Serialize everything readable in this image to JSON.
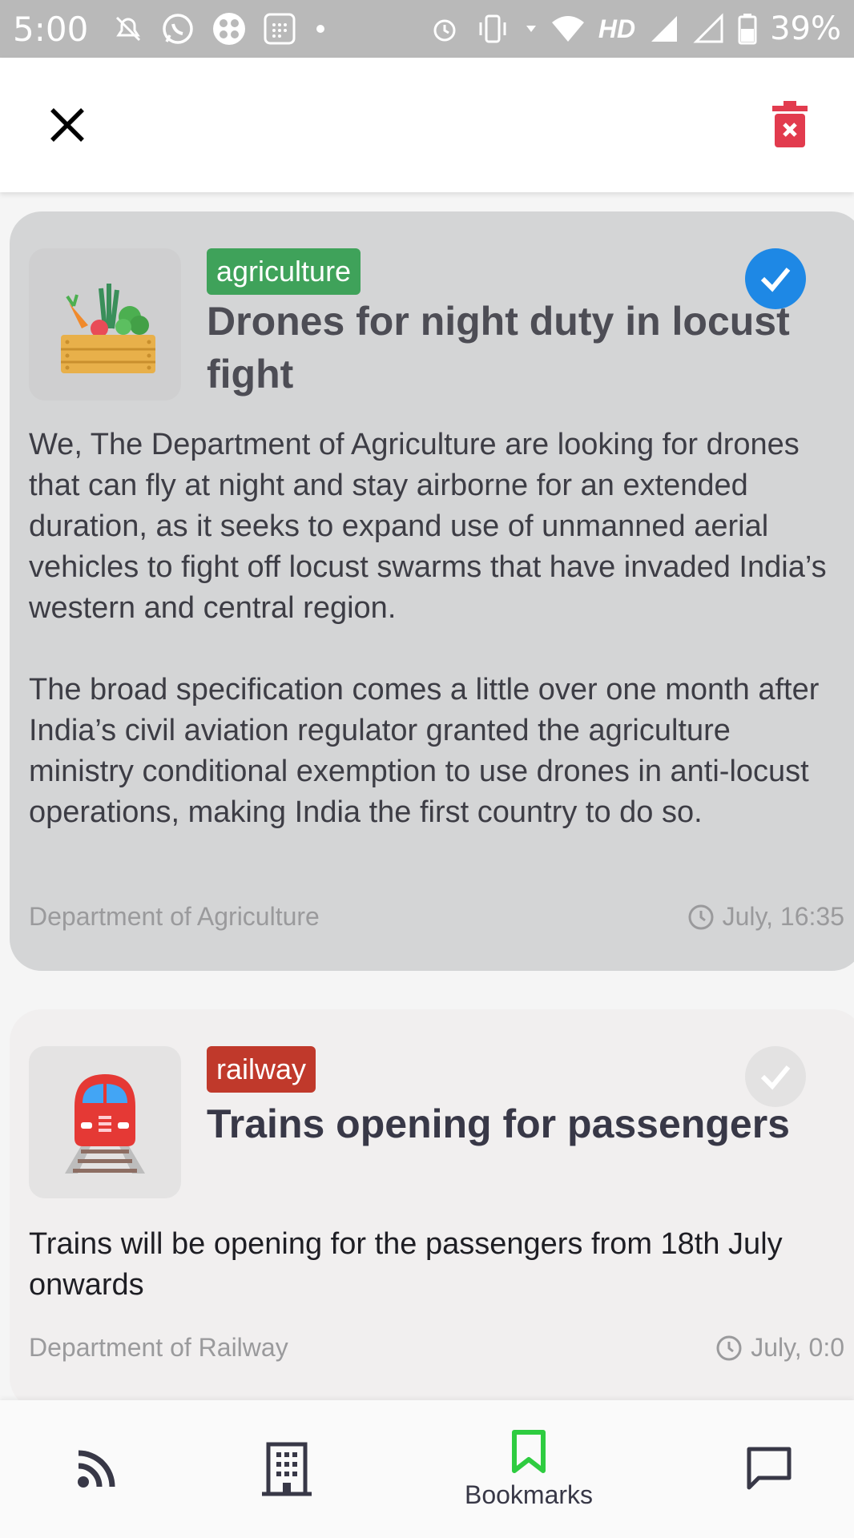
{
  "status_bar": {
    "time": "5:00",
    "network_label": "HD",
    "battery_percent": "39%"
  },
  "app_bar": {
    "close_icon": "close-icon",
    "delete_icon": "delete-bookmark-icon",
    "delete_color": "#e23b4e"
  },
  "cards": [
    {
      "category": "agriculture",
      "category_color": "#3fa25a",
      "title": "Drones for night duty in locust fight",
      "paragraphs": [
        "We, The Department of Agriculture are looking for drones that can fly at night and stay airborne for an extended duration, as it seeks to expand use of unmanned aerial vehicles to fight off locust swarms that have invaded India’s western and central region.",
        "The broad specification comes a little over one month after India’s civil aviation regulator granted the agriculture ministry conditional exemption to use drones in anti-locust operations, making India the first country to do so."
      ],
      "source": "Department of Agriculture",
      "time": "July, 16:35",
      "selected": true,
      "icon": "vegetable-crate-icon"
    },
    {
      "category": "railway",
      "category_color": "#c0392b",
      "title": "Trains opening for passengers",
      "paragraphs": [
        "Trains will be opening for the passengers from 18th July onwards"
      ],
      "source": "Department of Railway",
      "time": "July, 0:0",
      "selected": false,
      "icon": "train-icon"
    }
  ],
  "bottom_nav": {
    "feed_icon": "rss-feed-icon",
    "departments_icon": "building-icon",
    "bookmarks_label": "Bookmarks",
    "bookmarks_icon": "bookmark-icon",
    "active_color": "#2ecc40",
    "chat_icon": "chat-icon"
  }
}
